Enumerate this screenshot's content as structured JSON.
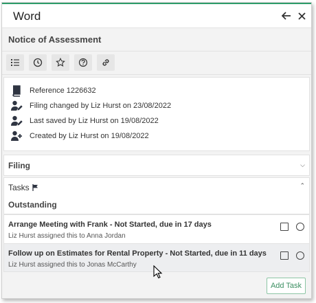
{
  "header": {
    "app_title": "Word",
    "back_icon": "arrow-left-icon",
    "close_icon": "close-icon"
  },
  "document": {
    "title": "Notice of Assessment"
  },
  "toolbar": {
    "buttons": [
      "list-icon",
      "clock-icon",
      "star-icon",
      "help-icon",
      "link-icon"
    ]
  },
  "info": {
    "reference": "Reference 1226632",
    "filing_changed": "Filing changed by Liz Hurst on 23/08/2022",
    "last_saved": "Last saved by Liz Hurst on 19/08/2022",
    "created": "Created by Liz Hurst on 19/08/2022"
  },
  "filing": {
    "label": "Filing"
  },
  "tasks": {
    "label": "Tasks",
    "outstanding_label": "Outstanding",
    "items": [
      {
        "title": "Arrange Meeting with Frank - Not Started, due in 17 days",
        "subtitle": "Liz Hurst assigned this to Anna Jordan"
      },
      {
        "title": "Follow up on Estimates for Rental Property - Not Started, due in 11 days",
        "subtitle": "Liz Hurst assigned this to Jonas McCarthy"
      }
    ],
    "add_label": "Add Task"
  },
  "colors": {
    "accent": "#2e9c6a",
    "add_button": "#3c8f62"
  }
}
